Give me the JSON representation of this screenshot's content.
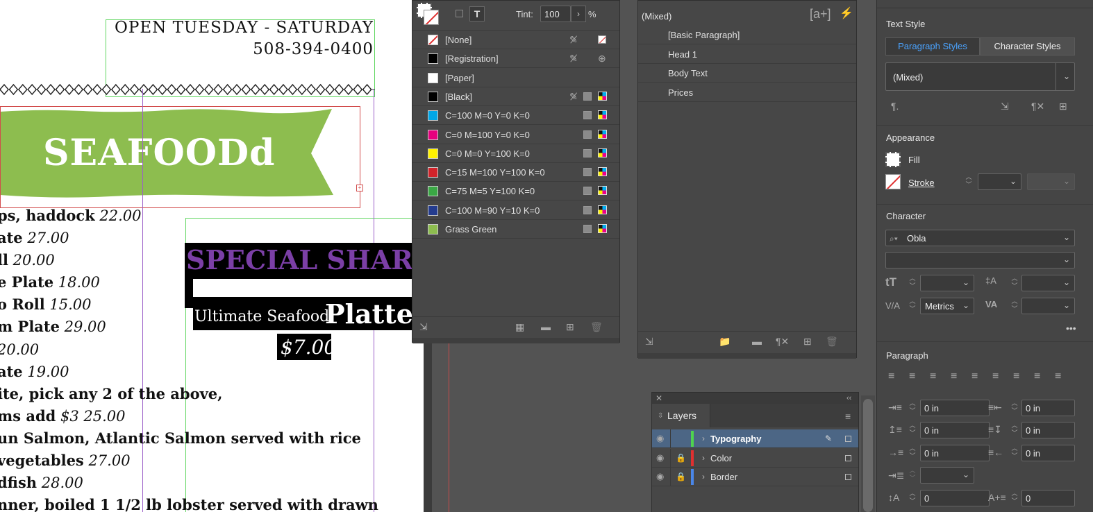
{
  "document": {
    "hours_line1": "OPEN TUESDAY - SATURDAY",
    "hours_line2": "508-394-0400",
    "banner_title": "SEAFOODd",
    "menu_lines": [
      {
        "text": "ps, haddock",
        "price": "22.00"
      },
      {
        "text": "ate",
        "price": "27.00"
      },
      {
        "text": "ll",
        "price": "20.00"
      },
      {
        "text": "e Plate",
        "price": "18.00"
      },
      {
        "text": "o Roll",
        "price": "15.00"
      },
      {
        "text": "m Plate",
        "price": "29.00"
      },
      {
        "text": "",
        "price": "20.00"
      },
      {
        "text": "ate",
        "price": "19.00"
      },
      {
        "text": "ite, pick any 2 of the above,",
        "price": ""
      },
      {
        "text": "ms add",
        "price": "$3   25.00"
      },
      {
        "text": "un Salmon, Atlantic Salmon served with rice",
        "price": ""
      },
      {
        "text": "vegetables",
        "price": "27.00"
      },
      {
        "text": "dfish",
        "price": "28.00"
      },
      {
        "text": "nner, boiled 1 1/2 lb lobster served with drawn",
        "price": ""
      }
    ],
    "special_title": "SPECIAL SHARER",
    "platter_small": "Ultimate Seafood",
    "platter_big": "Platter",
    "platter_price": "$7.00"
  },
  "swatches": {
    "tint_label": "Tint:",
    "tint_value": "100",
    "tint_unit": "%",
    "items": [
      {
        "name": "[None]",
        "color": "#ffffff",
        "none": true
      },
      {
        "name": "[Registration]",
        "color": "#000000"
      },
      {
        "name": "[Paper]",
        "color": "#ffffff"
      },
      {
        "name": "[Black]",
        "color": "#000000"
      },
      {
        "name": "C=100 M=0 Y=0 K=0",
        "color": "#00a6e6"
      },
      {
        "name": "C=0 M=100 Y=0 K=0",
        "color": "#e6007e"
      },
      {
        "name": "C=0 M=0 Y=100 K=0",
        "color": "#fff200"
      },
      {
        "name": "C=15 M=100 Y=100 K=0",
        "color": "#d2232a"
      },
      {
        "name": "C=75 M=5 Y=100 K=0",
        "color": "#3aa845"
      },
      {
        "name": "C=100 M=90 Y=10 K=0",
        "color": "#243c8f"
      },
      {
        "name": "Grass Green",
        "color": "#8dbd4f"
      }
    ]
  },
  "para_styles": {
    "header": "(Mixed)",
    "items": [
      "[Basic Paragraph]",
      "Head 1",
      "Body Text",
      "Prices"
    ]
  },
  "layers": {
    "title": "Layers",
    "items": [
      {
        "name": "Typography",
        "color": "#4fd34f"
      },
      {
        "name": "Color",
        "color": "#e03030"
      },
      {
        "name": "Border",
        "color": "#4a86e8"
      }
    ]
  },
  "properties": {
    "text_style_title": "Text Style",
    "tab_paragraph": "Paragraph Styles",
    "tab_character": "Character Styles",
    "style_value": "(Mixed)",
    "appearance_title": "Appearance",
    "fill_label": "Fill",
    "stroke_label": "Stroke",
    "character_title": "Character",
    "font_value": "Obla",
    "kerning_value": "Metrics",
    "paragraph_title": "Paragraph",
    "indent_left": "0 in",
    "indent_right": "0 in",
    "space_before": "0 in",
    "space_after": "0 in",
    "first_indent": "0 in",
    "last_indent": "0 in",
    "dropcap_lines": "0",
    "dropcap_chars": "0"
  },
  "colors": {
    "banner_green": "#8dbd4f",
    "special_purple": "#7b3fa6",
    "accent_blue": "#4aa3ff"
  }
}
